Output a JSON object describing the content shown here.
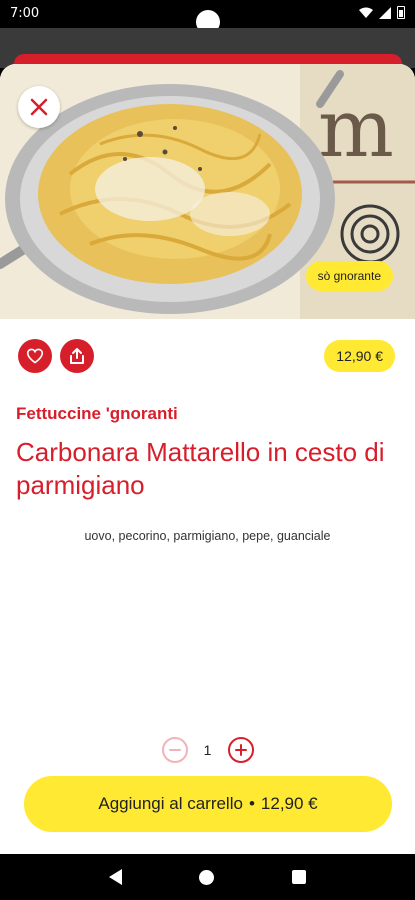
{
  "status": {
    "time": "7:00"
  },
  "hero": {
    "tag": "sò gnorante"
  },
  "product": {
    "price": "12,90 €",
    "category": "Fettuccine 'gnoranti",
    "title": "Carbonara Mattarello in cesto di parmigiano",
    "ingredients": "uovo, pecorino, parmigiano, pepe, guanciale"
  },
  "quantity": {
    "value": "1"
  },
  "cart_button": {
    "label": "Aggiungi al carrello",
    "separator": "•",
    "total": "12,90 €"
  },
  "colors": {
    "brand_red": "#d71f2c",
    "accent_yellow": "#ffe933"
  },
  "icons": [
    "close-icon",
    "heart-icon",
    "share-icon",
    "minus-icon",
    "plus-icon",
    "wifi-icon",
    "signal-icon",
    "battery-icon",
    "back-icon",
    "home-icon",
    "recents-icon"
  ]
}
